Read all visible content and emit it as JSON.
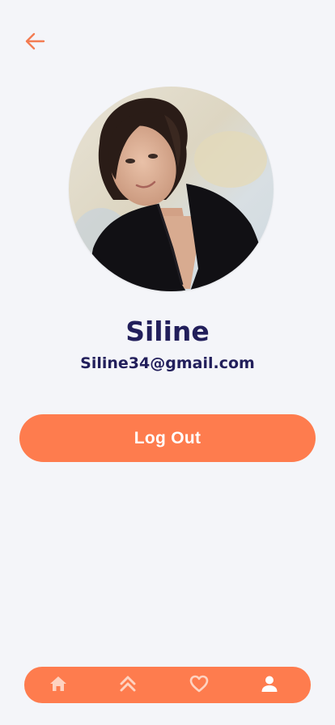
{
  "header": {
    "back_icon": "arrow-left-icon"
  },
  "profile": {
    "name": "Siline",
    "email": "Siline34@gmail.com",
    "avatar_alt": "profile photo"
  },
  "actions": {
    "logout_label": "Log Out"
  },
  "bottom_nav": {
    "items": [
      {
        "icon": "home-icon",
        "active": false
      },
      {
        "icon": "double-chevron-up-icon",
        "active": false
      },
      {
        "icon": "heart-icon",
        "active": false
      },
      {
        "icon": "user-icon",
        "active": true
      }
    ]
  },
  "colors": {
    "background": "#f4f5f9",
    "accent": "#fe7c4e",
    "text_dark": "#221f5b",
    "nav_inactive": "#fed3c1",
    "nav_active": "#ffffff"
  }
}
